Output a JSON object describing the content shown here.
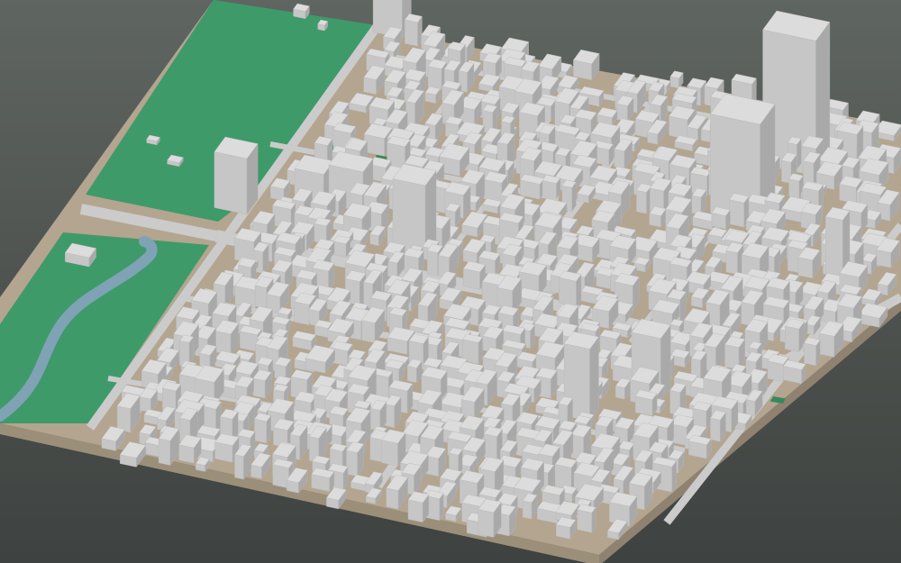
{
  "scene": {
    "kind": "3d-city-block-model",
    "view": "isometric-oblique",
    "has_text": false
  },
  "colors": {
    "background_top": "#5f6561",
    "background_bottom": "#3e4240",
    "ground": "#b3a58f",
    "ground_edge": "#8f8270",
    "ground_side": "#9c8f7a",
    "road": "#cbcbcb",
    "park": "#3f9a6a",
    "park_dark": "#37875d",
    "river": "#7fa2b5",
    "building_top": "#dcdcdc",
    "building_left": "#c6c6c6",
    "building_right": "#a9a9a9"
  },
  "features": {
    "parks": [
      "north-park",
      "river-park",
      "small-green-patches"
    ],
    "water": [
      "creek"
    ],
    "roads": [
      "east-west-avenues",
      "north-south-streets",
      "diagonal-highway"
    ],
    "buildings": [
      "low-rise-blocks",
      "mid-rise-blocks",
      "towers"
    ]
  }
}
